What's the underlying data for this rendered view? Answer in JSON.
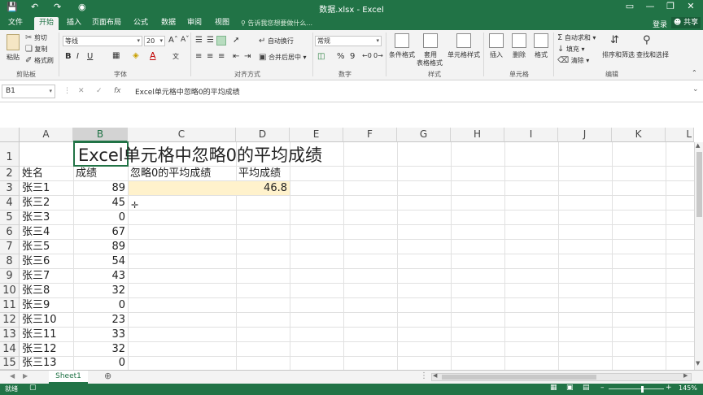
{
  "titlebar": {
    "title": "数据.xlsx - Excel",
    "save_icon": "save-icon",
    "undo_icon": "undo-icon",
    "redo_icon": "redo-icon",
    "camera_icon": "camera-icon"
  },
  "tabs": [
    {
      "label": "文件"
    },
    {
      "label": "开始"
    },
    {
      "label": "插入"
    },
    {
      "label": "页面布局"
    },
    {
      "label": "公式"
    },
    {
      "label": "数据"
    },
    {
      "label": "审阅"
    },
    {
      "label": "视图"
    }
  ],
  "tell_me": "告诉我您想要做什么...",
  "login": "登录",
  "share": "共享",
  "ribbon": {
    "clipboard": {
      "paste": "粘贴",
      "cut": "剪切",
      "copy": "复制",
      "format_painter": "格式刷",
      "label": "剪贴板"
    },
    "font": {
      "name": "等线",
      "size": "20",
      "bold": "B",
      "italic": "I",
      "underline": "U",
      "label": "字体"
    },
    "alignment": {
      "wrap": "自动换行",
      "merge": "合并后居中",
      "label": "对齐方式"
    },
    "number": {
      "format": "常规",
      "percent": "%",
      "comma": "9",
      "label": "数字"
    },
    "styles": {
      "conditional": "条件格式",
      "table": "套用",
      "table2": "表格格式",
      "cell_styles": "单元格样式",
      "label": "样式"
    },
    "cells": {
      "insert": "插入",
      "delete": "删除",
      "format": "格式",
      "label": "单元格"
    },
    "editing": {
      "autosum": "自动求和",
      "fill": "填充",
      "clear": "清除",
      "sort": "排序和筛选",
      "find": "查找和选择",
      "label": "编辑"
    }
  },
  "formula_bar": {
    "name_box": "B1",
    "content": "Excel单元格中忽略0的平均成绩"
  },
  "columns": [
    "A",
    "B",
    "C",
    "D",
    "E",
    "F",
    "G",
    "H",
    "I",
    "J",
    "K",
    "L"
  ],
  "rows": [
    "1",
    "2",
    "3",
    "4",
    "5",
    "6",
    "7",
    "8",
    "9",
    "10",
    "11",
    "12",
    "13",
    "14",
    "15"
  ],
  "cells": {
    "title": "Excel单元格中忽略0的平均成绩",
    "header_name": "姓名",
    "header_score": "成绩",
    "header_avg_ignore": "忽略0的平均成绩",
    "header_avg": "平均成绩",
    "avg_value": "46.8",
    "names": [
      "张三1",
      "张三2",
      "张三3",
      "张三4",
      "张三5",
      "张三6",
      "张三7",
      "张三8",
      "张三9",
      "张三10",
      "张三11",
      "张三12",
      "张三13"
    ],
    "scores": [
      "89",
      "45",
      "0",
      "67",
      "89",
      "54",
      "43",
      "32",
      "0",
      "23",
      "33",
      "32",
      "0"
    ]
  },
  "sheet_tab": "Sheet1",
  "status": {
    "ready": "就绪",
    "zoom": "145%"
  },
  "colors": {
    "excel_green": "#217346",
    "highlight": "#fff2cc"
  }
}
